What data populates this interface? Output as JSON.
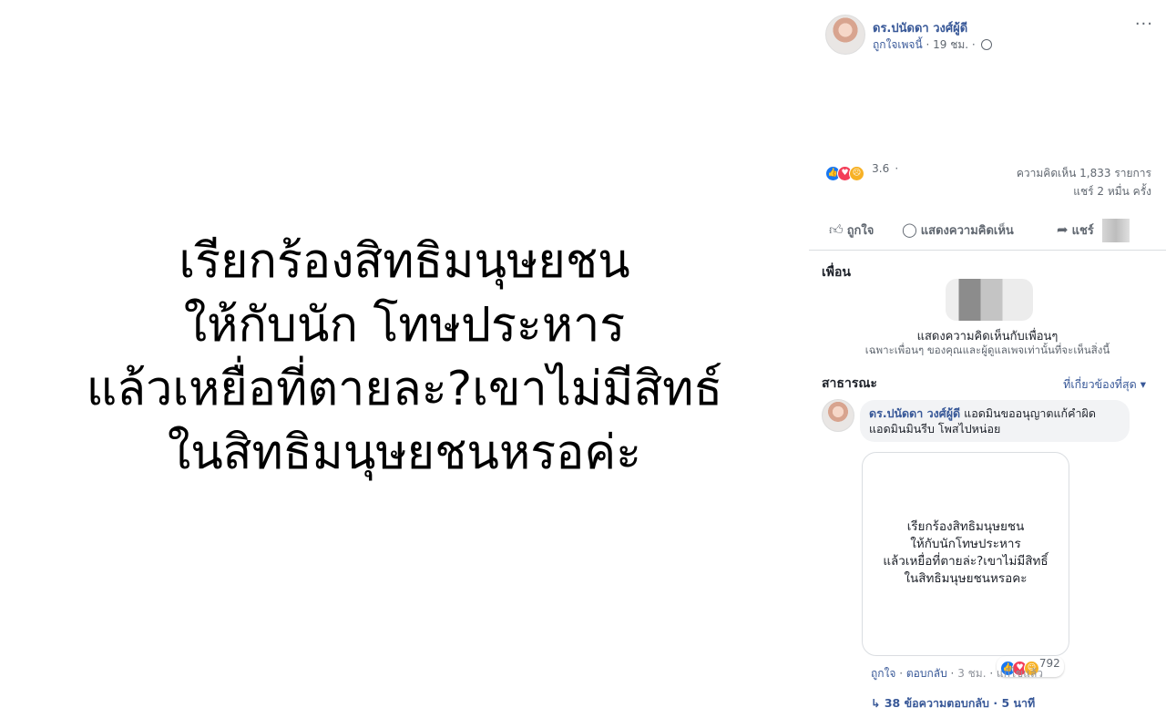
{
  "photo": {
    "lines": [
      "เรียกร้องสิทธิมนุษยชน",
      "ให้กับนัก โทษประหาร",
      "แล้วเหยื่อที่ตายละ?เขาไม่มีสิทธ์",
      "ในสิทธิมนุษยชนหรอค่ะ"
    ]
  },
  "post": {
    "author": "ดร.ปนัดดา วงศ์ผู้ดี",
    "liked_page": "ถูกใจเพจนี้",
    "time": " · 19 ชม. · ",
    "more": "···",
    "reaction_count": "3.6",
    "reaction_suffix": "·",
    "comments_count": "ความคิดเห็น 1,833 รายการ",
    "shares_count": "แชร์ 2 หมื่น ครั้ง"
  },
  "actions": {
    "like": "ถูกใจ",
    "comment": "แสดงความคิดเห็น",
    "share": "แชร์"
  },
  "friends": {
    "label": "เพื่อน",
    "main": "แสดงความคิดเห็นกับเพื่อนๆ",
    "sub": "เฉพาะเพื่อนๆ ของคุณและผู้ดูแลเพจเท่านั้นที่จะเห็นสิ่งนี้"
  },
  "public": {
    "label": "สาธารณะ",
    "sort": "ที่เกี่ยวข้องที่สุด ▾"
  },
  "comment": {
    "author": "ดร.ปนัดดา วงศ์ผู้ดี",
    "text": " แอดมินขออนุญาตแก้คำผิด แอดมินมินรีบ โพสไปหน่อย",
    "attachment_lines": [
      "เรียกร้องสิทธิมนุษยชน",
      "ให้กับนักโทษประหาร",
      "แล้วเหยื่อที่ตายล่ะ?เขาไม่มีสิทธิ์",
      "ในสิทธิมนุษยชนหรอคะ"
    ],
    "reaction_count": "792",
    "like": "ถูกใจ",
    "reply": "ตอบกลับ",
    "time": "3 ชม.",
    "edited": "แก้ไขแล้ว",
    "replies": "38 ข้อความตอบกลับ · 5 นาที"
  },
  "colors": {
    "link": "#385898",
    "muted": "#606770",
    "like": "#1877f2",
    "love": "#f33e58"
  }
}
